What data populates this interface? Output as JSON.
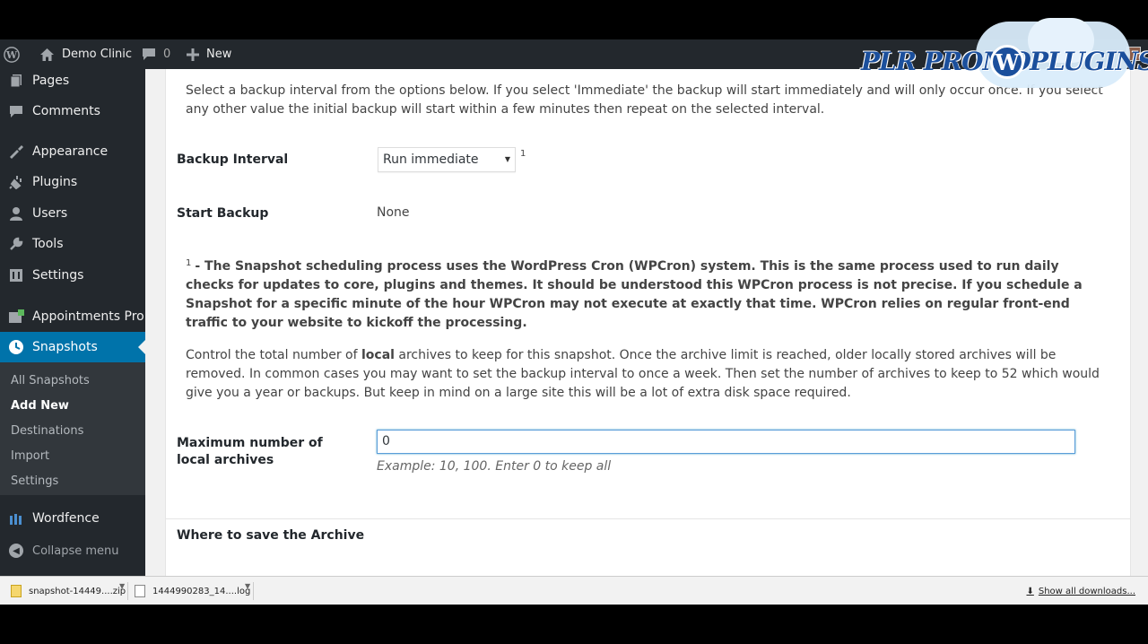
{
  "admin_bar": {
    "site_name": "Demo Clinic",
    "comments_count": "0",
    "new_label": "New"
  },
  "watermark": {
    "text_left": "PLR PROMO",
    "text_right": "PLUGINS",
    "logo_letter": "W"
  },
  "sidebar": {
    "items": [
      {
        "label": "Pages",
        "icon": "pages-icon"
      },
      {
        "label": "Comments",
        "icon": "comments-icon"
      },
      {
        "label": "Appearance",
        "icon": "appearance-icon"
      },
      {
        "label": "Plugins",
        "icon": "plugins-icon"
      },
      {
        "label": "Users",
        "icon": "users-icon"
      },
      {
        "label": "Tools",
        "icon": "tools-icon"
      },
      {
        "label": "Settings",
        "icon": "settings-icon"
      },
      {
        "label": "Appointments Pro",
        "icon": "appointments-icon"
      },
      {
        "label": "Snapshots",
        "icon": "snapshots-icon",
        "current": true
      },
      {
        "label": "Wordfence",
        "icon": "wordfence-icon"
      }
    ],
    "submenu": [
      "All Snapshots",
      "Add New",
      "Destinations",
      "Import",
      "Settings"
    ],
    "submenu_current": "Add New",
    "collapse_label": "Collapse menu"
  },
  "main": {
    "interval_desc": "Select a backup interval from the options below. If you select 'Immediate' the backup will start immediately and will only occur once. If you select any other value the initial backup will start within a few minutes then repeat on the selected interval.",
    "backup_interval_label": "Backup Interval",
    "backup_interval_value": "Run immediate",
    "footnote_marker": "1",
    "start_backup_label": "Start Backup",
    "start_backup_value": "None",
    "footnote_text": "- The Snapshot scheduling process uses the WordPress Cron (WPCron) system. This is the same process used to run daily checks for updates to core, plugins and themes. It should be understood this WPCron process is not precise. If you schedule a Snapshot for a specific minute of the hour WPCron may not execute at exactly that time. WPCron relies on regular front-end traffic to your website to kickoff the processing.",
    "archives_desc_pre": "Control the total number of ",
    "archives_desc_bold": "local",
    "archives_desc_post": " archives to keep for this snapshot. Once the archive limit is reached, older locally stored archives will be removed. In common cases you may want to set the backup interval to once a week. Then set the number of archives to keep to 52 which would give you a year or backups. But keep in mind on a large site this will be a lot of extra disk space required.",
    "max_archives_label": "Maximum number of local archives",
    "max_archives_value": "0",
    "max_archives_hint": "Example: 10, 100. Enter 0 to keep all",
    "where_to_save_title": "Where to save the Archive"
  },
  "downloads": {
    "items": [
      {
        "name": "snapshot-14449....zip",
        "type": "zip"
      },
      {
        "name": "1444990283_14....log",
        "type": "log"
      }
    ],
    "show_all": "Show all downloads..."
  }
}
